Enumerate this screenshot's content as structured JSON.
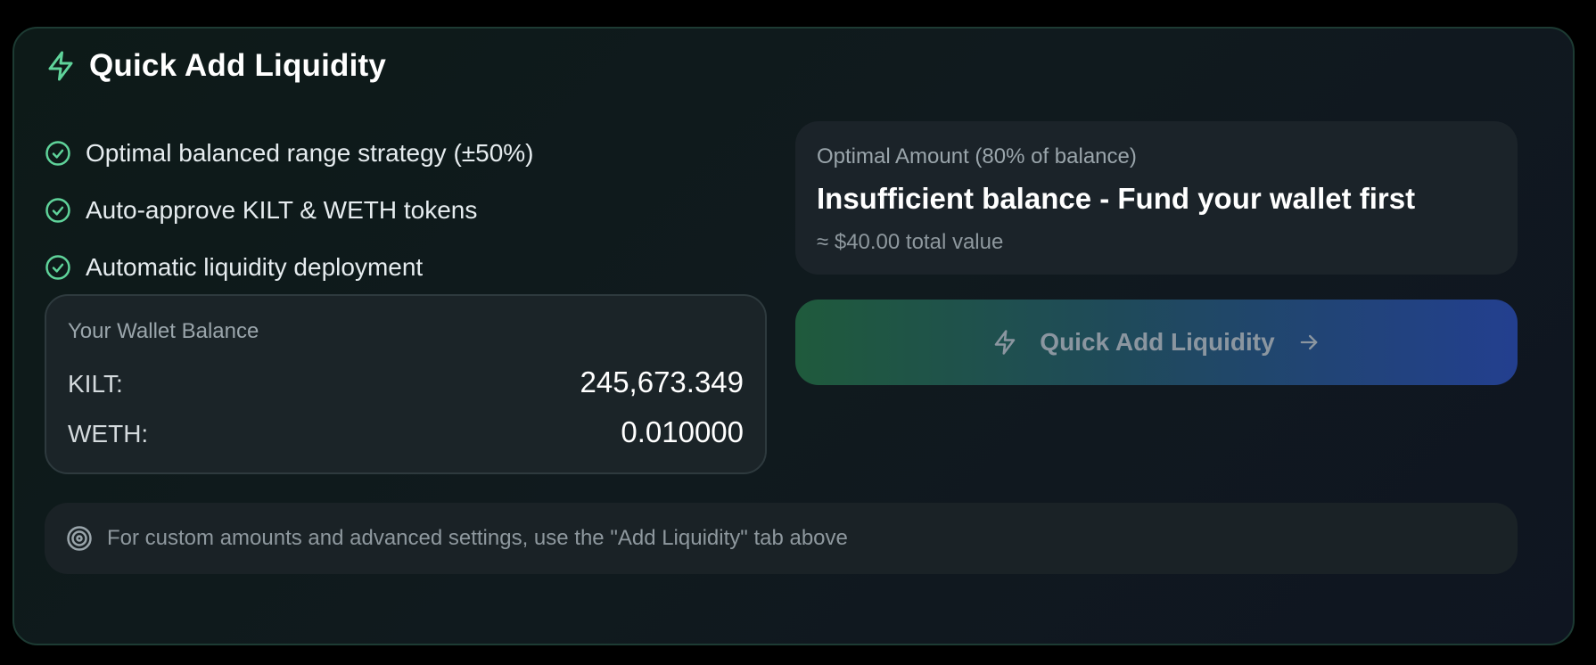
{
  "header": {
    "title": "Quick Add Liquidity",
    "icon": "lightning-bolt-icon",
    "accent_color": "#5fd39a"
  },
  "features": [
    {
      "label": "Optimal balanced range strategy (±50%)",
      "icon": "check-circle-icon"
    },
    {
      "label": "Auto-approve KILT & WETH tokens",
      "icon": "check-circle-icon"
    },
    {
      "label": "Automatic liquidity deployment",
      "icon": "check-circle-icon"
    }
  ],
  "wallet": {
    "title": "Your Wallet Balance",
    "rows": [
      {
        "label": "KILT:",
        "value": "245,673.349"
      },
      {
        "label": "WETH:",
        "value": "0.010000"
      }
    ]
  },
  "optimal": {
    "label": "Optimal Amount (80% of balance)",
    "message": "Insufficient balance - Fund your wallet first",
    "sub": "≈ $40.00 total value"
  },
  "quick_button": {
    "label": "Quick Add Liquidity",
    "icon_left": "lightning-bolt-icon",
    "icon_right": "arrow-right-icon",
    "gradient_start": "#1f5a3c",
    "gradient_end": "#233f8f"
  },
  "footer": {
    "text": "For custom amounts and advanced settings, use the \"Add Liquidity\" tab above",
    "icon": "target-icon"
  }
}
